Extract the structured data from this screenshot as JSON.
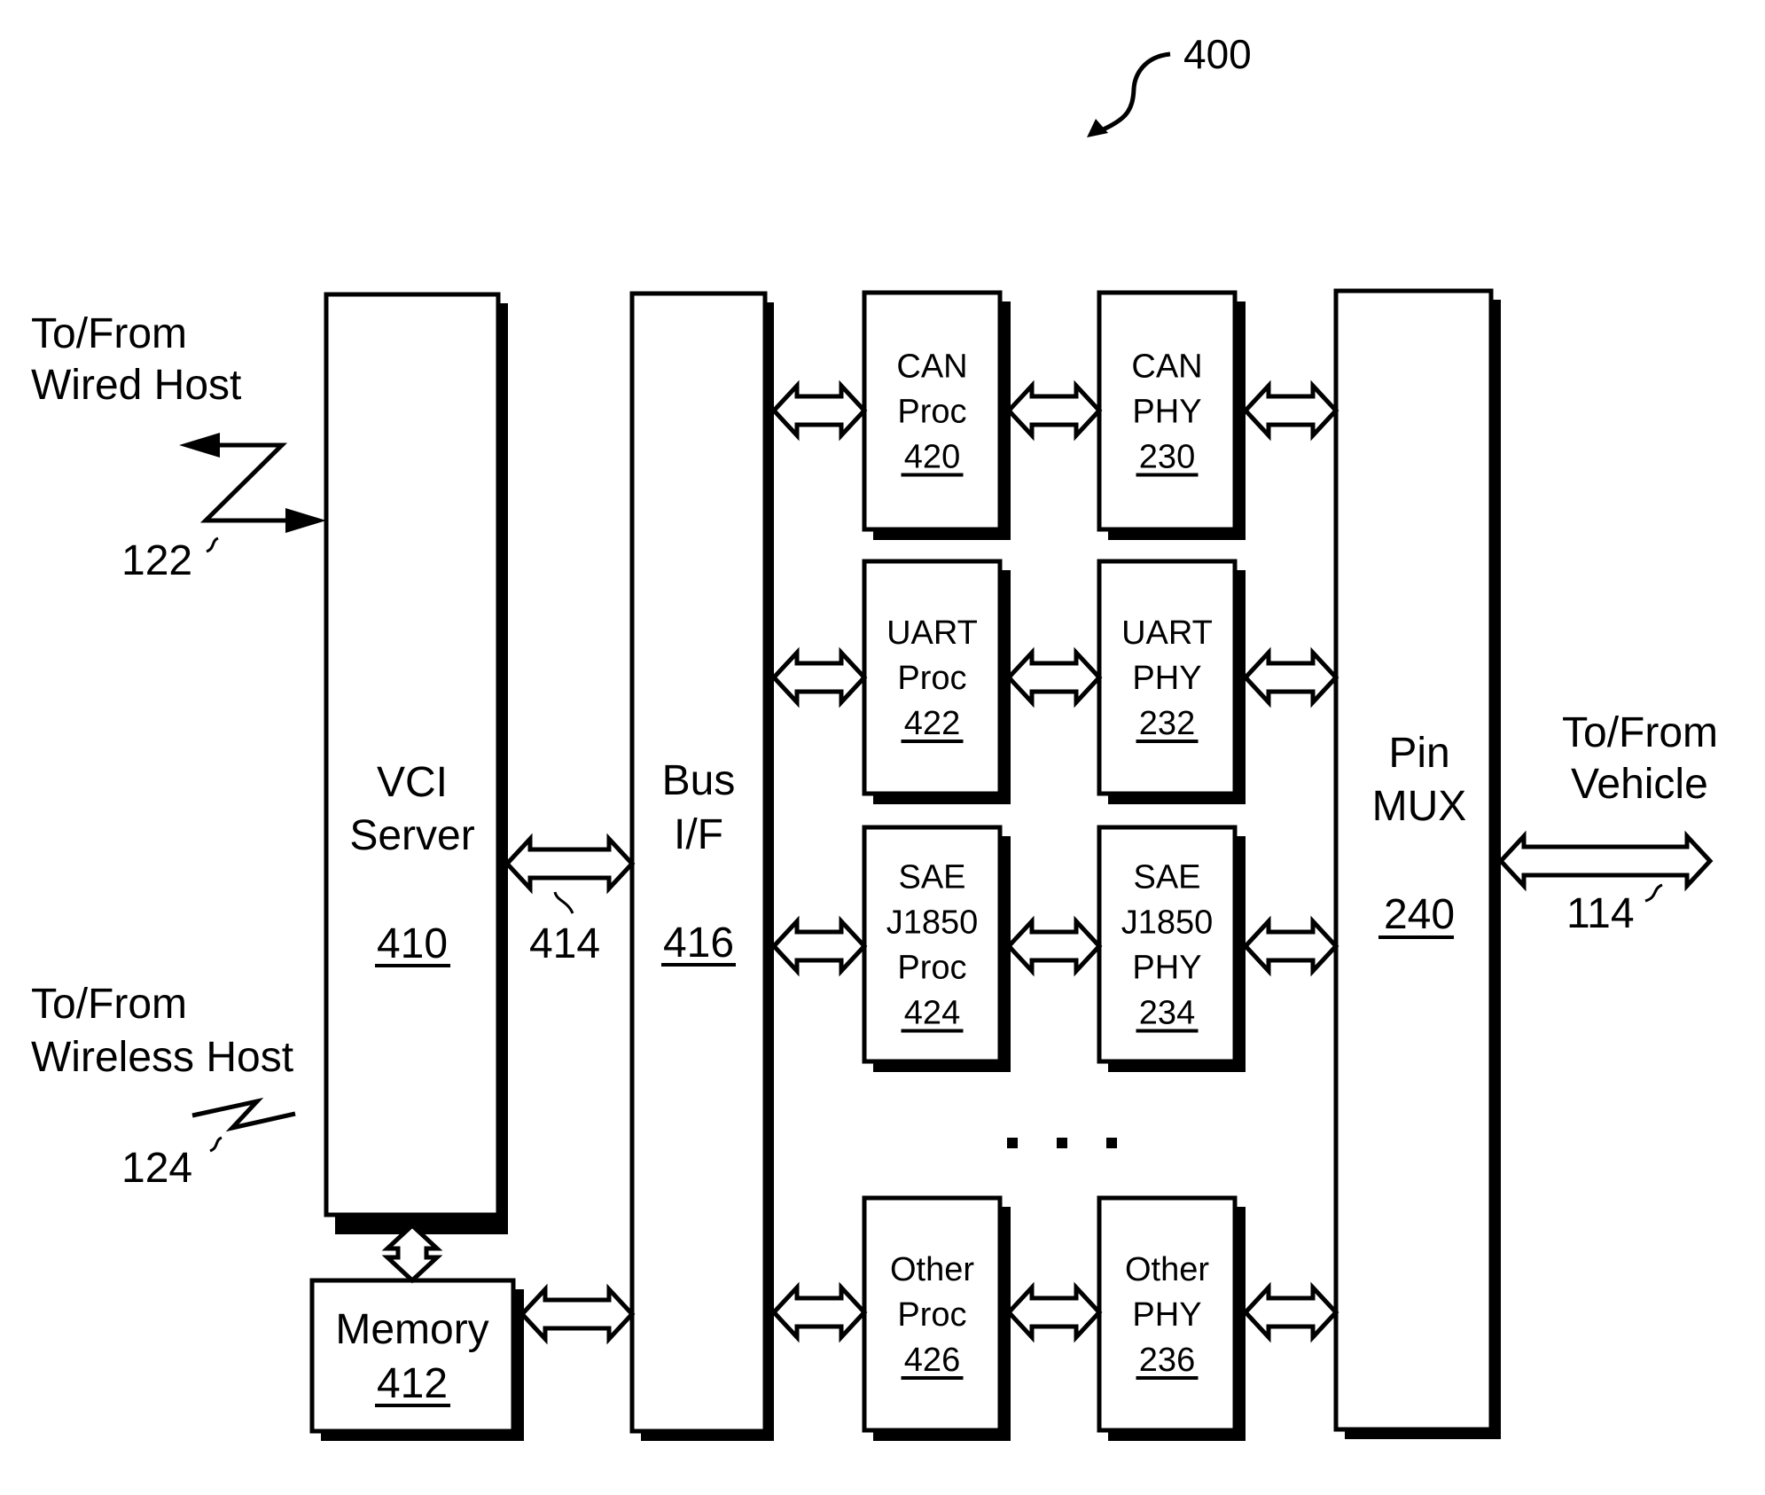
{
  "figure": {
    "reference": "400"
  },
  "external": {
    "wired_host": {
      "line1": "To/From",
      "line2": "Wired Host",
      "ref": "122"
    },
    "wireless_host": {
      "line1": "To/From",
      "line2": "Wireless Host",
      "ref": "124"
    },
    "vehicle": {
      "line1": "To/From",
      "line2": "Vehicle",
      "ref": "114"
    }
  },
  "blocks": {
    "vci_server": {
      "lines": [
        "VCI",
        "Server"
      ],
      "ref": "410"
    },
    "memory": {
      "lines": [
        "Memory"
      ],
      "ref": "412"
    },
    "vci_bus_link": {
      "ref": "414"
    },
    "bus_if": {
      "lines": [
        "Bus",
        "I/F"
      ],
      "ref": "416"
    },
    "pin_mux": {
      "lines": [
        "Pin",
        "MUX"
      ],
      "ref": "240"
    }
  },
  "rows": [
    {
      "proc": {
        "lines": [
          "CAN",
          "Proc"
        ],
        "ref": "420"
      },
      "phy": {
        "lines": [
          "CAN",
          "PHY"
        ],
        "ref": "230"
      }
    },
    {
      "proc": {
        "lines": [
          "UART",
          "Proc"
        ],
        "ref": "422"
      },
      "phy": {
        "lines": [
          "UART",
          "PHY"
        ],
        "ref": "232"
      }
    },
    {
      "proc": {
        "lines": [
          "SAE",
          "J1850",
          "Proc"
        ],
        "ref": "424"
      },
      "phy": {
        "lines": [
          "SAE",
          "J1850",
          "PHY"
        ],
        "ref": "234"
      }
    },
    {
      "proc": {
        "lines": [
          "Other",
          "Proc"
        ],
        "ref": "426"
      },
      "phy": {
        "lines": [
          "Other",
          "PHY"
        ],
        "ref": "236"
      }
    }
  ],
  "ellipsis": "..."
}
